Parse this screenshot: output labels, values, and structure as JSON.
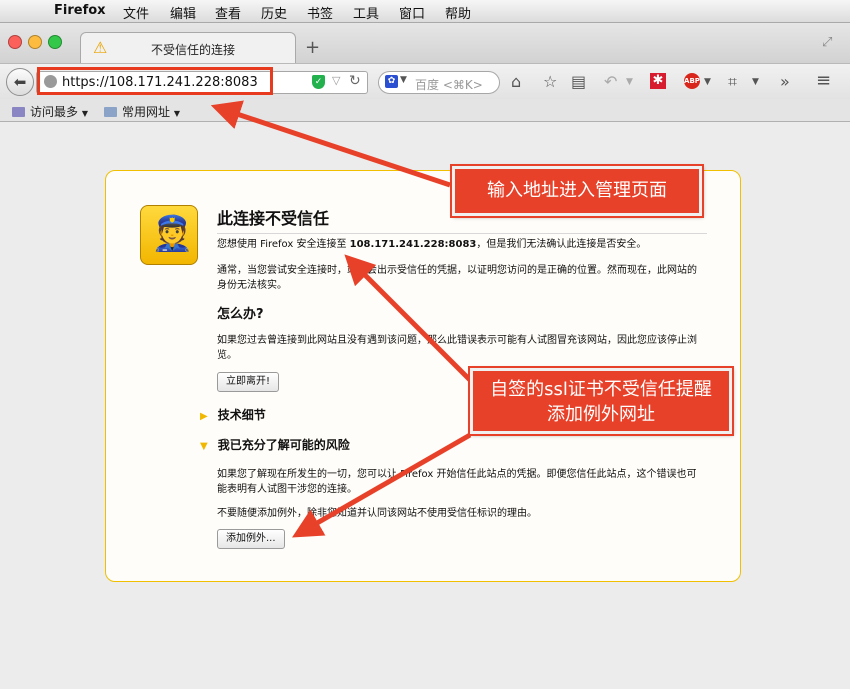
{
  "menubar": {
    "app_name": "Firefox",
    "items": [
      "文件",
      "编辑",
      "查看",
      "历史",
      "书签",
      "工具",
      "窗口",
      "帮助"
    ]
  },
  "tab": {
    "title": "不受信任的连接",
    "icon": "warning-icon"
  },
  "navbar": {
    "url": "https://108.171.241.228:8083",
    "search_placeholder": "百度 <⌘K>",
    "abp_label": "ABP"
  },
  "bookmarks": {
    "items": [
      "访问最多",
      "常用网址"
    ]
  },
  "error_page": {
    "title": "此连接不受信任",
    "intro_prefix": "您想使用 Firefox 安全连接至 ",
    "intro_host": "108.171.241.228:8083",
    "intro_suffix": "，但是我们无法确认此连接是否安全。",
    "explanation": "通常，当您尝试安全连接时，站点会出示受信任的凭据，以证明您访问的是正确的位置。然而现在，此网站的身份无法核实。",
    "what_to_do_heading": "怎么办?",
    "what_to_do_text": "如果您过去曾连接到此网站且没有遇到该问题，那么此错误表示可能有人试图冒充该网站，因此您应该停止浏览。",
    "leave_button": "立即离开!",
    "technical_details_label": "技术细节",
    "understand_risks_label": "我已充分了解可能的风险",
    "risk_text": "如果您了解现在所发生的一切，您可以让 Firefox 开始信任此站点的凭据。即便您信任此站点，这个错误也可能表明有人试图干涉您的连接。",
    "warning_text": "不要随便添加例外，除非您知道并认同该网站不使用受信任标识的理由。",
    "add_exception_button": "添加例外..."
  },
  "annotations": {
    "callout_1": "输入地址进入管理页面",
    "callout_2_line1": "自签的ssl证书不受信任提醒",
    "callout_2_line2": "添加例外网址",
    "color": "#e8412a"
  }
}
